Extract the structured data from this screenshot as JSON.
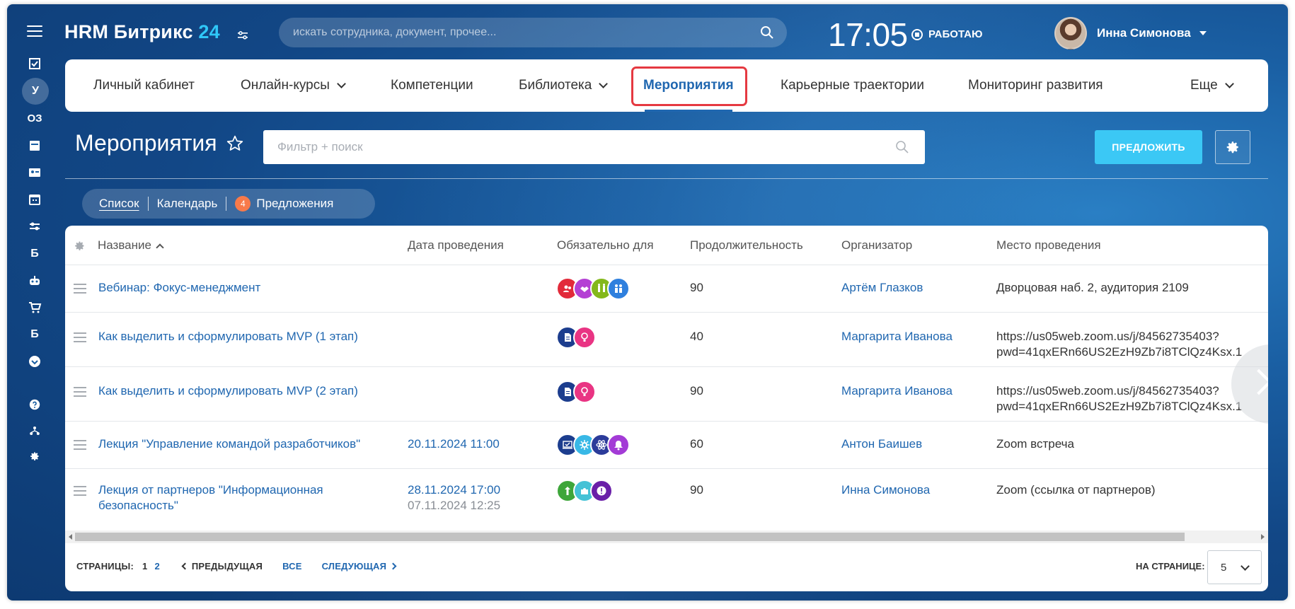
{
  "header": {
    "logo_text": "HRM Битрикс ",
    "logo_num": "24",
    "search_placeholder": "искать сотрудника, документ, прочее...",
    "clock": "17:05",
    "work_status": "РАБОТАЮ",
    "user_name": "Инна Симонова"
  },
  "sidebar": {
    "letter_items": [
      "У",
      "ОЗ",
      "Б",
      "Б"
    ]
  },
  "nav": {
    "items": [
      {
        "label": "Личный кабинет"
      },
      {
        "label": "Онлайн-курсы"
      },
      {
        "label": "Компетенции"
      },
      {
        "label": "Библиотека"
      },
      {
        "label": "Мероприятия"
      },
      {
        "label": "Карьерные траектории"
      },
      {
        "label": "Мониторинг развития"
      },
      {
        "label": "Еще"
      }
    ]
  },
  "page": {
    "title": "Мероприятия",
    "filter_placeholder": "Фильтр + поиск",
    "propose_label": "ПРЕДЛОЖИТЬ"
  },
  "views": {
    "list": "Список",
    "calendar": "Календарь",
    "proposals": "Предложения",
    "proposals_count": "4"
  },
  "table": {
    "columns": [
      "Название",
      "Дата проведения",
      "Обязательно для",
      "Продолжительность",
      "Организатор",
      "Место проведения"
    ],
    "rows": [
      {
        "name": "Вебинар: Фокус-менеджмент",
        "name2": "",
        "date": "",
        "date2": "",
        "duration": "90",
        "organizer": "Артём Глазков",
        "place": "Дворцовая наб. 2, аудитория 2109",
        "place2": ""
      },
      {
        "name": "Как выделить и сформулировать MVP (1 этап)",
        "name2": "",
        "date": "",
        "date2": "",
        "duration": "40",
        "organizer": "Маргарита Иванова",
        "place": "https://us05web.zoom.us/j/84562735403?",
        "place2": "pwd=41qxERn66US2EzH9Zb7i8TClQz4Ksx.1"
      },
      {
        "name": "Как выделить и сформулировать MVP (2 этап)",
        "name2": "",
        "date": "",
        "date2": "",
        "duration": "90",
        "organizer": "Маргарита Иванова",
        "place": "https://us05web.zoom.us/j/84562735403?",
        "place2": "pwd=41qxERn66US2EzH9Zb7i8TClQz4Ksx.1"
      },
      {
        "name": "Лекция \"Управление командой разработчиков\"",
        "name2": "",
        "date": "20.11.2024 11:00",
        "date2": "",
        "duration": "60",
        "organizer": "Антон Баишев",
        "place": "Zoom встреча",
        "place2": ""
      },
      {
        "name": "Лекция от партнеров \"Информационная",
        "name2": "безопасность\"",
        "date": "28.11.2024 17:00",
        "date2": "07.11.2024 12:25",
        "duration": "90",
        "organizer": "Инна Симонова",
        "place": "Zoom (ссылка от партнеров)",
        "place2": ""
      }
    ]
  },
  "pager": {
    "pages_label": "СТРАНИЦЫ:",
    "page1": "1",
    "page2": "2",
    "prev": "ПРЕДЫДУЩАЯ",
    "all": "ВСЕ",
    "next": "СЛЕДУЮЩАЯ",
    "per_page_label": "НА СТРАНИЦЕ:",
    "per_page_value": "5"
  },
  "colors": {
    "accent": "#2067b0",
    "propose_button": "#3bc8f5",
    "active_outline": "#e53941",
    "badge": "#f87a4a"
  }
}
